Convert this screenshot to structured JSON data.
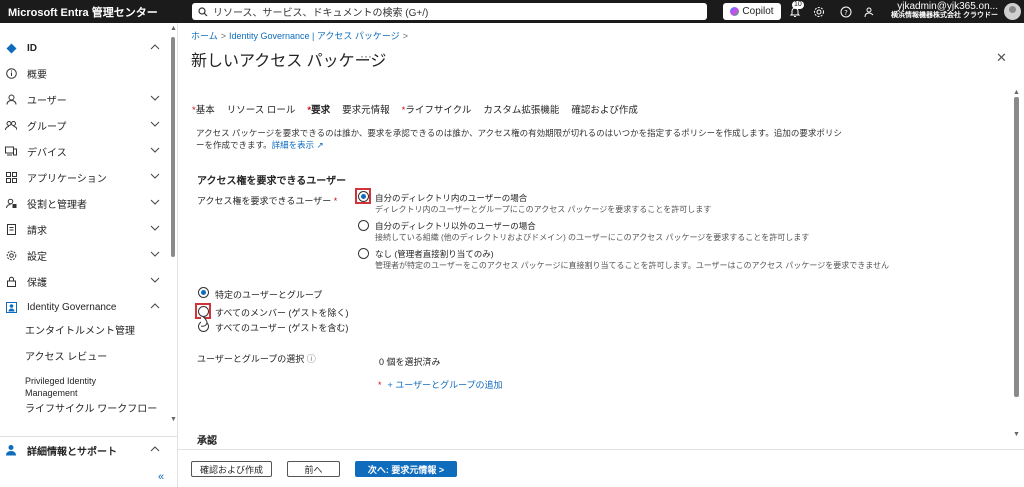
{
  "app": {
    "title": "Microsoft Entra 管理センター",
    "search_placeholder": "リソース、サービス、ドキュメントの検索 (G+/)",
    "copilot_label": "Copilot",
    "notification_count": "10",
    "account_name": "yjkadmin@yjk365.on...",
    "account_org": "横浜情報機器株式会社  クラウドー"
  },
  "sidebar": {
    "items": [
      {
        "label": "ID",
        "icon": "diamond-icon",
        "bold": true
      },
      {
        "label": "概要",
        "icon": "info-icon"
      },
      {
        "label": "ユーザー",
        "icon": "person-icon"
      },
      {
        "label": "グループ",
        "icon": "group-icon"
      },
      {
        "label": "デバイス",
        "icon": "device-icon"
      },
      {
        "label": "アプリケーション",
        "icon": "apps-icon"
      },
      {
        "label": "役割と管理者",
        "icon": "role-icon"
      },
      {
        "label": "請求",
        "icon": "billing-icon"
      },
      {
        "label": "設定",
        "icon": "gear-icon"
      },
      {
        "label": "保護",
        "icon": "lock-icon"
      },
      {
        "label": "Identity Governance",
        "icon": "governance-icon"
      }
    ],
    "sub_items": [
      "エンタイトルメント管理",
      "アクセス レビュー",
      "Privileged Identity Management",
      "ライフサイクル ワークフロー"
    ],
    "help_label": "詳細情報とサポート",
    "collapse_glyph": "«"
  },
  "main": {
    "breadcrumb": [
      "ホーム",
      "Identity Governance | アクセス パッケージ"
    ],
    "title": "新しいアクセス パッケージ",
    "more_glyph": "···",
    "close_glyph": "✕",
    "tabs": [
      {
        "label": "基本",
        "required": true
      },
      {
        "label": "リソース ロール",
        "required": false
      },
      {
        "label": "要求",
        "required": true,
        "active": true
      },
      {
        "label": "要求元情報",
        "required": false
      },
      {
        "label": "ライフサイクル",
        "required": true
      },
      {
        "label": "カスタム拡張機能",
        "required": false
      },
      {
        "label": "確認および作成",
        "required": false
      }
    ],
    "description": "アクセス パッケージを要求できるのは誰か、要求を承認できるのは誰か、アクセス権の有効期限が切れるのはいつかを指定するポリシーを作成します。追加の要求ポリシーを作成できます。",
    "description_link": "詳細を表示",
    "section_title": "アクセス権を要求できるユーザー",
    "field_label": "アクセス権を要求できるユーザー",
    "options": [
      {
        "title": "自分のディレクトリ内のユーザーの場合",
        "sub": "ディレクトリ内のユーザーとグループにこのアクセス パッケージを要求することを許可します",
        "selected": true
      },
      {
        "title": "自分のディレクトリ以外のユーザーの場合",
        "sub": "接続している組織 (他のディレクトリおよびドメイン) のユーザーにこのアクセス パッケージを要求することを許可します",
        "selected": false
      },
      {
        "title": "なし (管理者直接割り当てのみ)",
        "sub": "管理者が特定のユーザーをこのアクセス パッケージに直接割り当てることを許可します。ユーザーはこのアクセス パッケージを要求できません",
        "selected": false
      }
    ],
    "scope_options": [
      {
        "label": "特定のユーザーとグループ",
        "selected": true
      },
      {
        "label": "すべてのメンバー (ゲストを除く)",
        "selected": false
      },
      {
        "label": "すべてのユーザー (ゲストを含む)",
        "selected": false
      }
    ],
    "select_label": "ユーザーとグループの選択",
    "selected_count": "0 個を選択済み",
    "add_link": "+ ユーザーとグループの追加",
    "approval_title": "承認"
  },
  "footer": {
    "review_create": "確認および作成",
    "previous": "前へ",
    "next": "次へ: 要求元情報 >"
  },
  "colors": {
    "accent": "#0f6cbd",
    "topbar": "#1b1b1b",
    "highlight": "#d13438"
  }
}
